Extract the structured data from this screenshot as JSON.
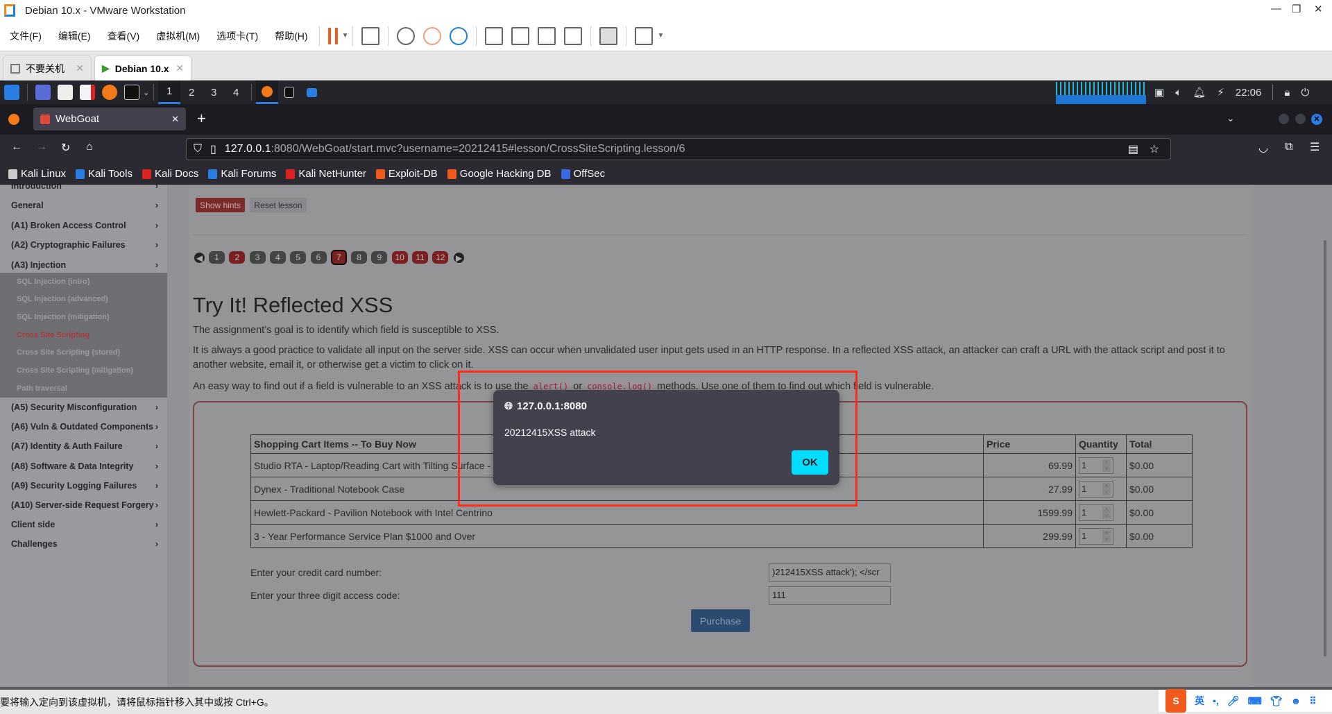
{
  "window": {
    "title": "Debian 10.x - VMware Workstation",
    "min": "—",
    "max": "❐",
    "close": "✕"
  },
  "menu": [
    "文件(F)",
    "编辑(E)",
    "查看(V)",
    "虚拟机(M)",
    "选项卡(T)",
    "帮助(H)"
  ],
  "vm_tabs": [
    {
      "label": "不要关机"
    },
    {
      "label": "Debian 10.x"
    }
  ],
  "kali_panel": {
    "workspaces": [
      "1",
      "2",
      "3",
      "4"
    ],
    "clock": "22:06"
  },
  "browser": {
    "tab_title": "WebGoat",
    "url_host": "127.0.0.1",
    "url_rest": ":8080/WebGoat/start.mvc?username=20212415#lesson/CrossSiteScripting.lesson/6",
    "bookmarks": [
      "Kali Linux",
      "Kali Tools",
      "Kali Docs",
      "Kali Forums",
      "Kali NetHunter",
      "Exploit-DB",
      "Google Hacking DB",
      "OffSec"
    ]
  },
  "sidebar": {
    "items": [
      "Introduction",
      "General",
      "(A1) Broken Access Control",
      "(A2) Cryptographic Failures",
      "(A3) Injection"
    ],
    "sub_items": [
      "SQL Injection (intro)",
      "SQL Injection (advanced)",
      "SQL Injection (mitigation)",
      "Cross Site Scripting",
      "Cross Site Scripting (stored)",
      "Cross Site Scripting (mitigation)",
      "Path traversal"
    ],
    "items_after": [
      "(A5) Security Misconfiguration",
      "(A6) Vuln & Outdated Components",
      "(A7) Identity & Auth Failure",
      "(A8) Software & Data Integrity",
      "(A9) Security Logging Failures",
      "(A10) Server-side Request Forgery",
      "Client side",
      "Challenges"
    ]
  },
  "lesson": {
    "show_hints": "Show hints",
    "reset": "Reset lesson",
    "pages": [
      "1",
      "2",
      "3",
      "4",
      "5",
      "6",
      "7",
      "8",
      "9",
      "10",
      "11",
      "12"
    ],
    "completed_pages": [
      "2",
      "10",
      "11",
      "12"
    ],
    "current_page": "7",
    "title": "Try It! Reflected XSS",
    "p1": "The assignment’s goal is to identify which field is susceptible to XSS.",
    "p2": "It is always a good practice to validate all input on the server side. XSS can occur when unvalidated user input gets used in an HTTP response. In a reflected XSS attack, an attacker can craft a URL with the attack script and post it to another website, email it, or otherwise get a victim to click on it.",
    "p3a": "An easy way to find out if a field is vulnerable to an XSS attack is to use the",
    "code1": "alert()",
    "p3b": "or",
    "code2": "console.log()",
    "p3c": "methods. Use one of them to find out which field is vulnerable.",
    "table": {
      "headers": [
        "Shopping Cart Items -- To Buy Now",
        "Price",
        "Quantity",
        "Total"
      ],
      "rows": [
        [
          "Studio RTA - Laptop/Reading Cart with Tilting Surface - Cherry",
          "69.99",
          "1",
          "$0.00"
        ],
        [
          "Dynex - Traditional Notebook Case",
          "27.99",
          "1",
          "$0.00"
        ],
        [
          "Hewlett-Packard - Pavilion Notebook with Intel Centrino",
          "1599.99",
          "1",
          "$0.00"
        ],
        [
          "3 - Year Performance Service Plan $1000 and Over",
          "299.99",
          "1",
          "$0.00"
        ]
      ]
    },
    "cc_label": "Enter your credit card number:",
    "cc_value": ")212415XSS attack'); </scr",
    "code_label": "Enter your three digit access code:",
    "code_value": "111",
    "purchase": "Purchase"
  },
  "dialog": {
    "host": "127.0.0.1:8080",
    "message": "20212415XSS attack",
    "ok": "OK"
  },
  "status": {
    "text": "要将输入定向到该虚拟机，请将鼠标指针移入其中或按 Ctrl+G。",
    "ime": "英"
  }
}
